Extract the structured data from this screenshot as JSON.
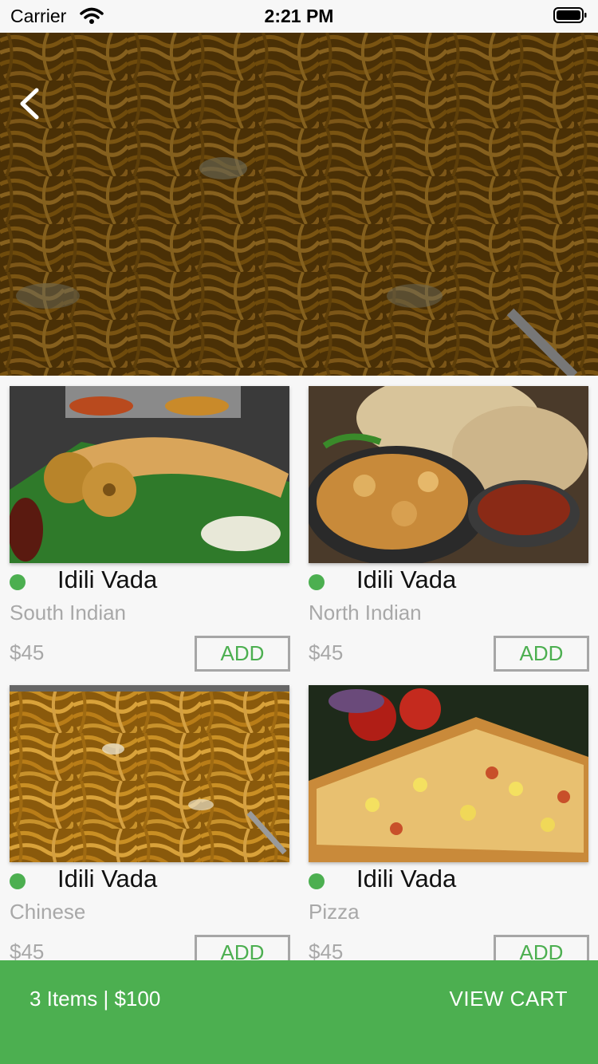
{
  "status_bar": {
    "carrier": "Carrier",
    "time": "2:21 PM"
  },
  "hero": {
    "image": "noodles-photo",
    "back_icon": "chevron-left-icon"
  },
  "items": [
    {
      "name": "Idili Vada",
      "cuisine": "South Indian",
      "price": "$45",
      "add_label": "ADD",
      "image": "dosa-vada-photo"
    },
    {
      "name": "Idili Vada",
      "cuisine": "North Indian",
      "price": "$45",
      "add_label": "ADD",
      "image": "roti-curry-photo"
    },
    {
      "name": "Idili Vada",
      "cuisine": "Chinese",
      "price": "$45",
      "add_label": "ADD",
      "image": "noodles-photo"
    },
    {
      "name": "Idili Vada",
      "cuisine": "Pizza",
      "price": "$45",
      "add_label": "ADD",
      "image": "pizza-photo"
    }
  ],
  "cart": {
    "summary": "3 Items | $100",
    "action_label": "VIEW CART"
  },
  "colors": {
    "accent": "#4caf50",
    "veg_dot": "#4caf50",
    "muted_text": "#a8a8a8"
  }
}
